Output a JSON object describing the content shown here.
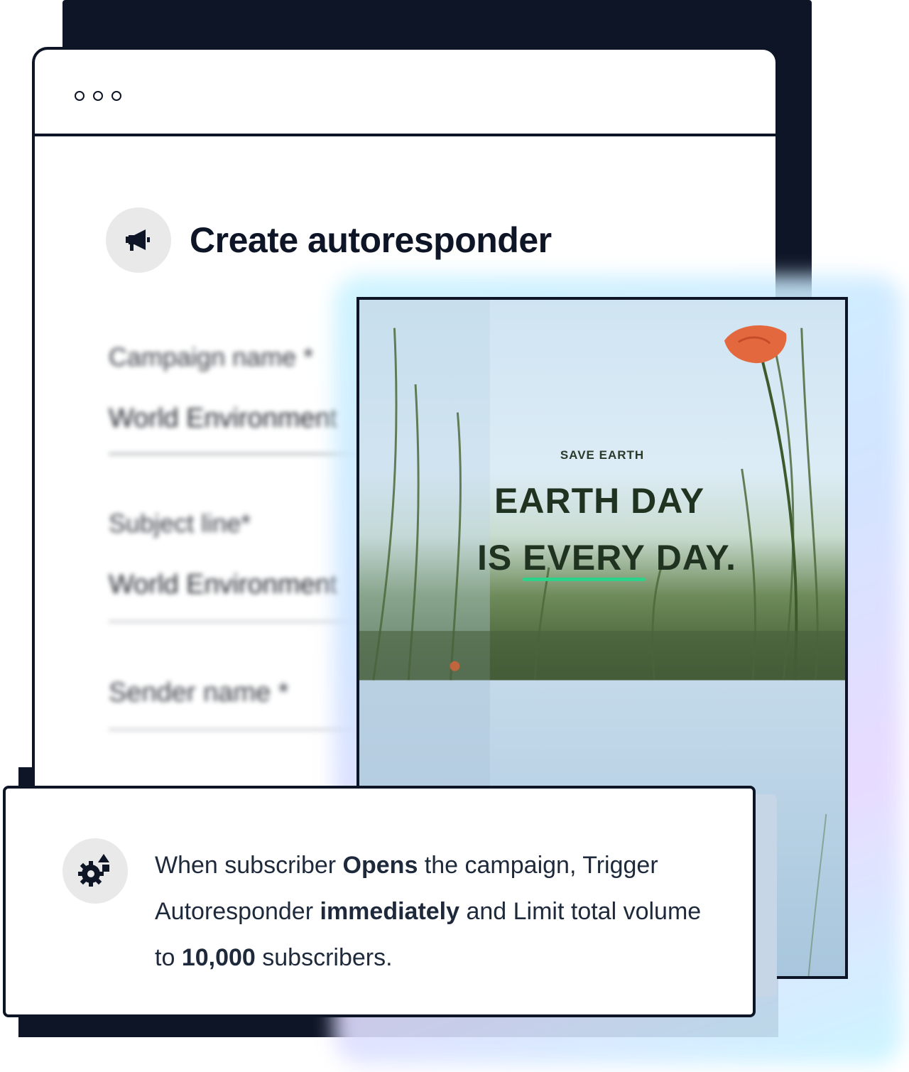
{
  "window": {
    "title": "Create autoresponder"
  },
  "form": {
    "campaign_label": "Campaign name *",
    "campaign_value": "World Environment",
    "subject_label": "Subject line*",
    "subject_value": "World Environment",
    "sender_label": "Sender name *"
  },
  "preview": {
    "eyebrow": "SAVE EARTH",
    "line1": "EARTH DAY",
    "line2_pre": "IS ",
    "line2_highlight": "EVERY",
    "line2_post": " DAY.",
    "accent_color": "#2bd48a"
  },
  "trigger": {
    "p1": "When subscriber ",
    "b1": "Opens",
    "p2": " the campaign, Trigger Autoresponder ",
    "b2": "immediately",
    "p3": " and Limit total volume to ",
    "b3": "10,000",
    "p4": " subscribers."
  },
  "icons": {
    "heading": "megaphone-icon",
    "trigger": "gear-shapes-icon"
  }
}
